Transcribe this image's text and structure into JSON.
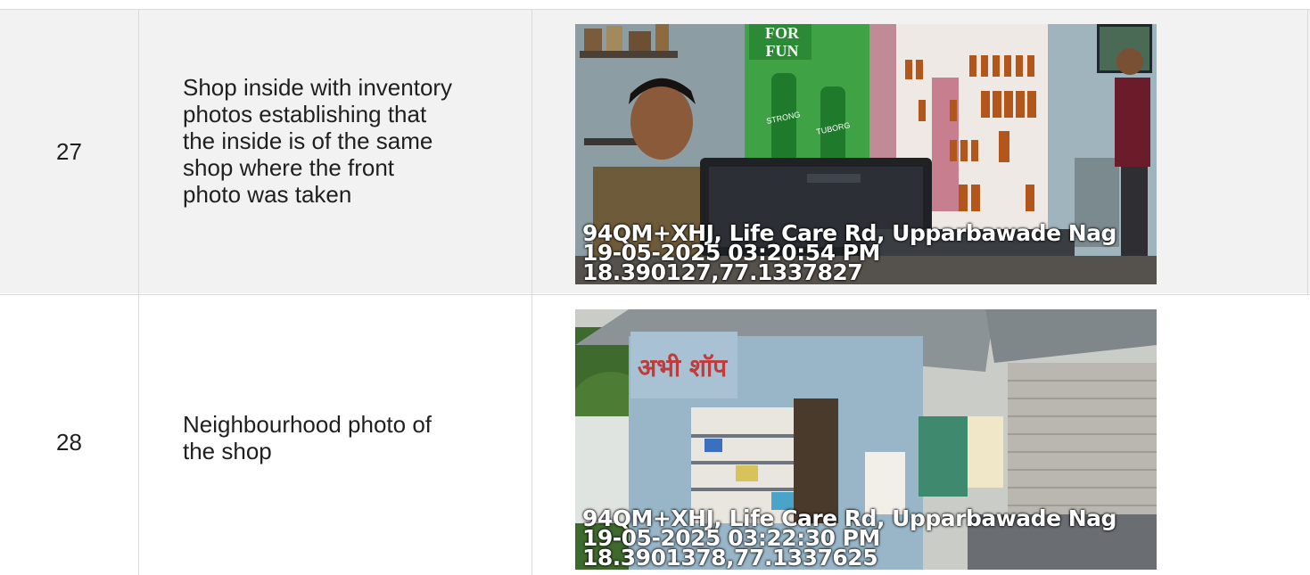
{
  "rows": [
    {
      "number": "27",
      "description_lines": [
        "Shop inside with inventory",
        "photos establishing that",
        "the inside is of the same",
        "shop where the front",
        "photo was taken"
      ],
      "photo": {
        "kind": "shop-interior-photo",
        "sign_text": [
          "FOR",
          "FUN"
        ],
        "bottle_labels": [
          "STRONG",
          "TUBORG"
        ],
        "stamp": {
          "address": "94QM+XHJ, Life Care Rd, Upparbawade Nag",
          "datetime": "19-05-2025 03:20:54 PM",
          "coords": "18.390127,77.1337827"
        }
      }
    },
    {
      "number": "28",
      "description_lines": [
        "Neighbourhood photo of",
        "the shop"
      ],
      "photo": {
        "kind": "shop-exterior-photo",
        "sign_text": "अभी शॉप",
        "stamp": {
          "address": "94QM+XHJ, Life Care Rd, Upparbawade Nag",
          "datetime": "19-05-2025 03:22:30 PM",
          "coords": "18.3901378,77.1337625"
        }
      }
    }
  ]
}
